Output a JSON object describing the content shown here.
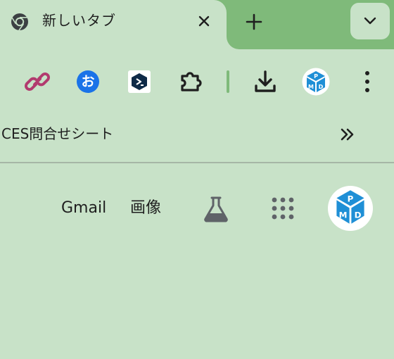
{
  "tab": {
    "title": "新しいタブ",
    "favicon": "chrome-icon"
  },
  "tab_strip": {
    "new_tab_icon": "plus-icon",
    "tab_search_icon": "chevron-down-icon"
  },
  "toolbar": {
    "extensions": [
      {
        "name": "link-extension-icon",
        "color": "#b23a6e"
      },
      {
        "name": "o-extension-icon",
        "label": "お",
        "color": "#1a73e8"
      },
      {
        "name": "terminal-extension-icon",
        "color": "#0e2a47"
      },
      {
        "name": "puzzle-extensions-icon",
        "color": "#1f1f1f"
      }
    ],
    "download_icon": "download-icon",
    "profile_icon": "pmd-logo-icon",
    "menu_icon": "kebab-menu-icon"
  },
  "bookmarks": {
    "items": [
      {
        "label": "CES問合せシート"
      }
    ],
    "overflow_icon": "double-chevron-right-icon"
  },
  "content": {
    "gmail_label": "Gmail",
    "images_label": "画像",
    "labs_icon": "flask-icon",
    "apps_icon": "apps-grid-icon",
    "account_icon": "pmd-logo-icon"
  },
  "colors": {
    "background": "#c8e2c8",
    "tab_strip": "#7fba7a",
    "pmd_blue": "#1f8fd6"
  }
}
